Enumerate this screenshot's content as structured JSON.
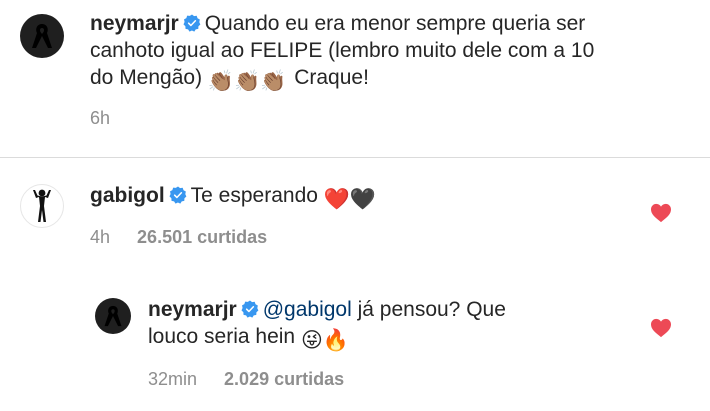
{
  "colors": {
    "like_red": "#ed4956",
    "verified_blue": "#3897f0",
    "meta_gray": "#8e8e8e",
    "mention": "#00376b"
  },
  "post": {
    "username": "neymarjr",
    "text_line1": "Quando eu era menor sempre queria ser",
    "text_line2": "canhoto igual ao FELIPE (lembro muito dele com a 10",
    "text_line3a": "do Mengão)",
    "text_line3b": "Craque!",
    "clap_emojis": "👏🏽👏🏽👏🏽",
    "time": "6h"
  },
  "comments": [
    {
      "username": "gabigol",
      "text": "Te esperando",
      "emojis": "❤️🖤",
      "time": "4h",
      "likes": "26.501 curtidas",
      "icon": "heart-icon"
    },
    {
      "username": "neymarjr",
      "mention": "@gabigol",
      "text1": "já pensou? Que",
      "text2": "louco seria hein",
      "emojis": "😜🔥",
      "time": "32min",
      "likes": "2.029 curtidas",
      "icon": "heart-icon"
    }
  ]
}
